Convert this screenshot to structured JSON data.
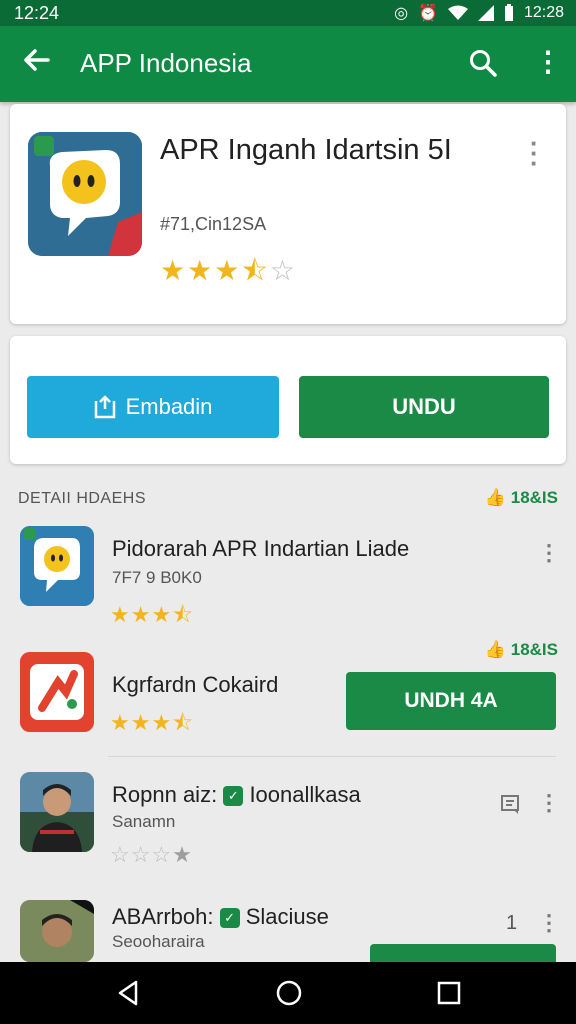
{
  "status_bar": {
    "time_left": "12:24",
    "time_right": "12:28",
    "icons": [
      "whatsapp-icon",
      "alarm-icon",
      "wifi-icon",
      "signal-icon",
      "battery-icon"
    ]
  },
  "app_bar": {
    "title": "APP Indonesia",
    "back_icon": "arrow-left-icon",
    "search_icon": "search-icon",
    "more_icon": "more-vert-icon"
  },
  "hero": {
    "name": "APR Inganh Idartsin 5I",
    "meta": "#71,Cin12SA",
    "rating": 3.5,
    "stars_total": 5
  },
  "actions": {
    "open_label": "Embadin",
    "install_label": "UNDU"
  },
  "section": {
    "title": "DETAII HDAEHS",
    "count": "18&IS"
  },
  "list": [
    {
      "title": "Pidorarah APR Indartian Liade",
      "subtitle": "7F7 9 B0K0",
      "rating": 3.5
    },
    {
      "count": "18&IS",
      "title": "Kgrfardn Cokaird",
      "rating": 3.5,
      "button": "UNDH 4A"
    },
    {
      "title_prefix": "Ropnn aiz:",
      "title_suffix": "Ioonallkasa",
      "subtitle": "Sanamn",
      "rating": 1
    },
    {
      "title_prefix": "ABArrboh:",
      "title_suffix": "Slaciuse",
      "subtitle": "Seooharaira",
      "side_text": "1"
    }
  ],
  "colors": {
    "status_bar": "#0b6b36",
    "app_bar": "#0f8a45",
    "install_green": "#1b8a47",
    "open_blue": "#20a9db",
    "star": "#f2b51e"
  }
}
